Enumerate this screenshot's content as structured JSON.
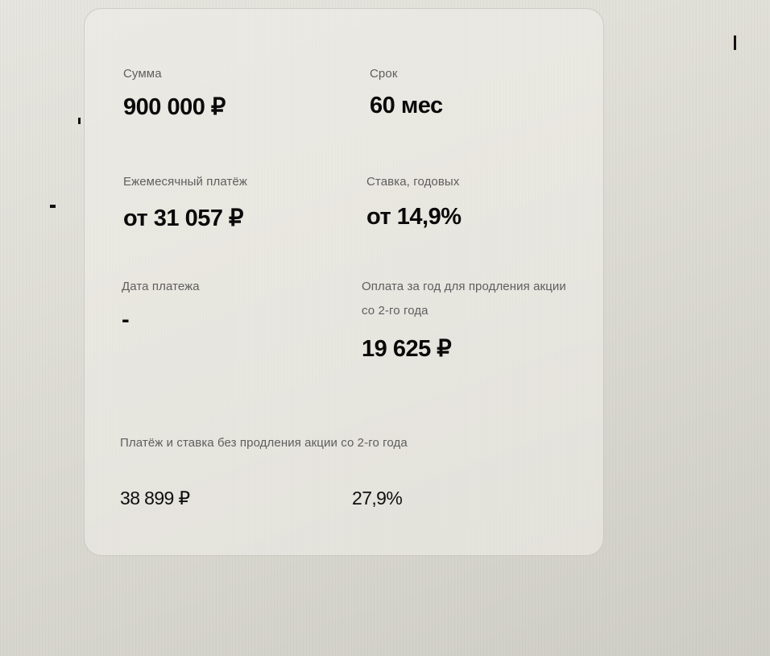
{
  "sum": {
    "label": "Сумма",
    "value": "900 000 ₽"
  },
  "term": {
    "label": "Срок",
    "value": "60 мес"
  },
  "monthly_payment": {
    "label": "Ежемесячный платёж",
    "value": "от 31 057 ₽"
  },
  "rate": {
    "label": "Ставка, годовых",
    "value": "от 14,9%"
  },
  "payment_date": {
    "label": "Дата платежа",
    "value": "-"
  },
  "promo_fee": {
    "label": "Оплата за год для продления акции со 2-го года",
    "value": "19 625 ₽"
  },
  "no_promo": {
    "label": "Платёж и ставка без продления акции со 2-го года",
    "payment": "38 899 ₽",
    "rate": "27,9%"
  }
}
